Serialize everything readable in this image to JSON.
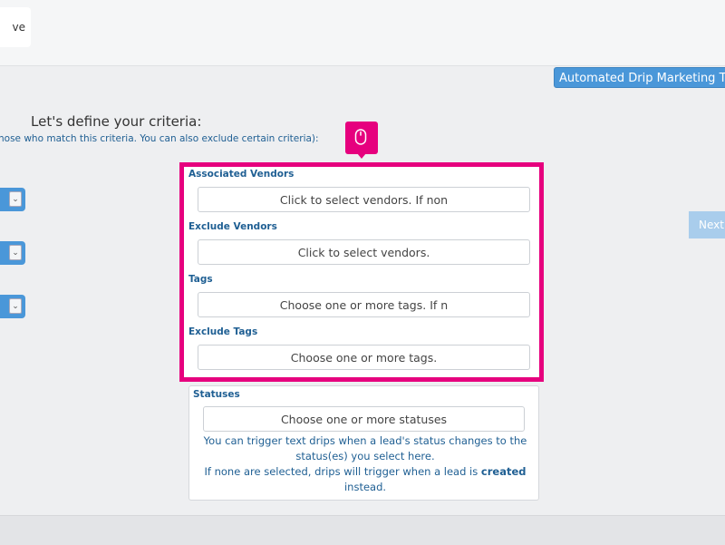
{
  "toolbar": {
    "save_label": "ve"
  },
  "header": {
    "automated_button": "Automated Drip Marketing Te"
  },
  "criteria": {
    "heading": "Let's define your criteria:",
    "subtext": "hose who match this criteria. You can also exclude certain criteria):"
  },
  "side_selects": [
    {
      "caret": "⌄"
    },
    {
      "caret": "⌄"
    },
    {
      "caret": "⌄"
    }
  ],
  "next_button": "Next",
  "form": {
    "associated_vendors": {
      "label": "Associated Vendors",
      "placeholder": "Click to select vendors. If non"
    },
    "exclude_vendors": {
      "label": "Exclude Vendors",
      "placeholder": "Click to select vendors."
    },
    "tags": {
      "label": "Tags",
      "placeholder": "Choose one or more tags. If n"
    },
    "exclude_tags": {
      "label": "Exclude Tags",
      "placeholder": "Choose one or more tags."
    },
    "statuses": {
      "label": "Statuses",
      "placeholder": "Choose one or more statuses",
      "help_line1": "You can trigger text drips when a lead's status changes to the status(es) you select here.",
      "help_line2_prefix": "If none are selected, drips will trigger when a lead is ",
      "help_line2_bold": "created",
      "help_line2_suffix": " instead."
    }
  },
  "colors": {
    "accent": "#e6007e",
    "primary": "#4a97d9",
    "label_text": "#1f5f93"
  },
  "icons": {
    "tip": "mouse-icon"
  }
}
